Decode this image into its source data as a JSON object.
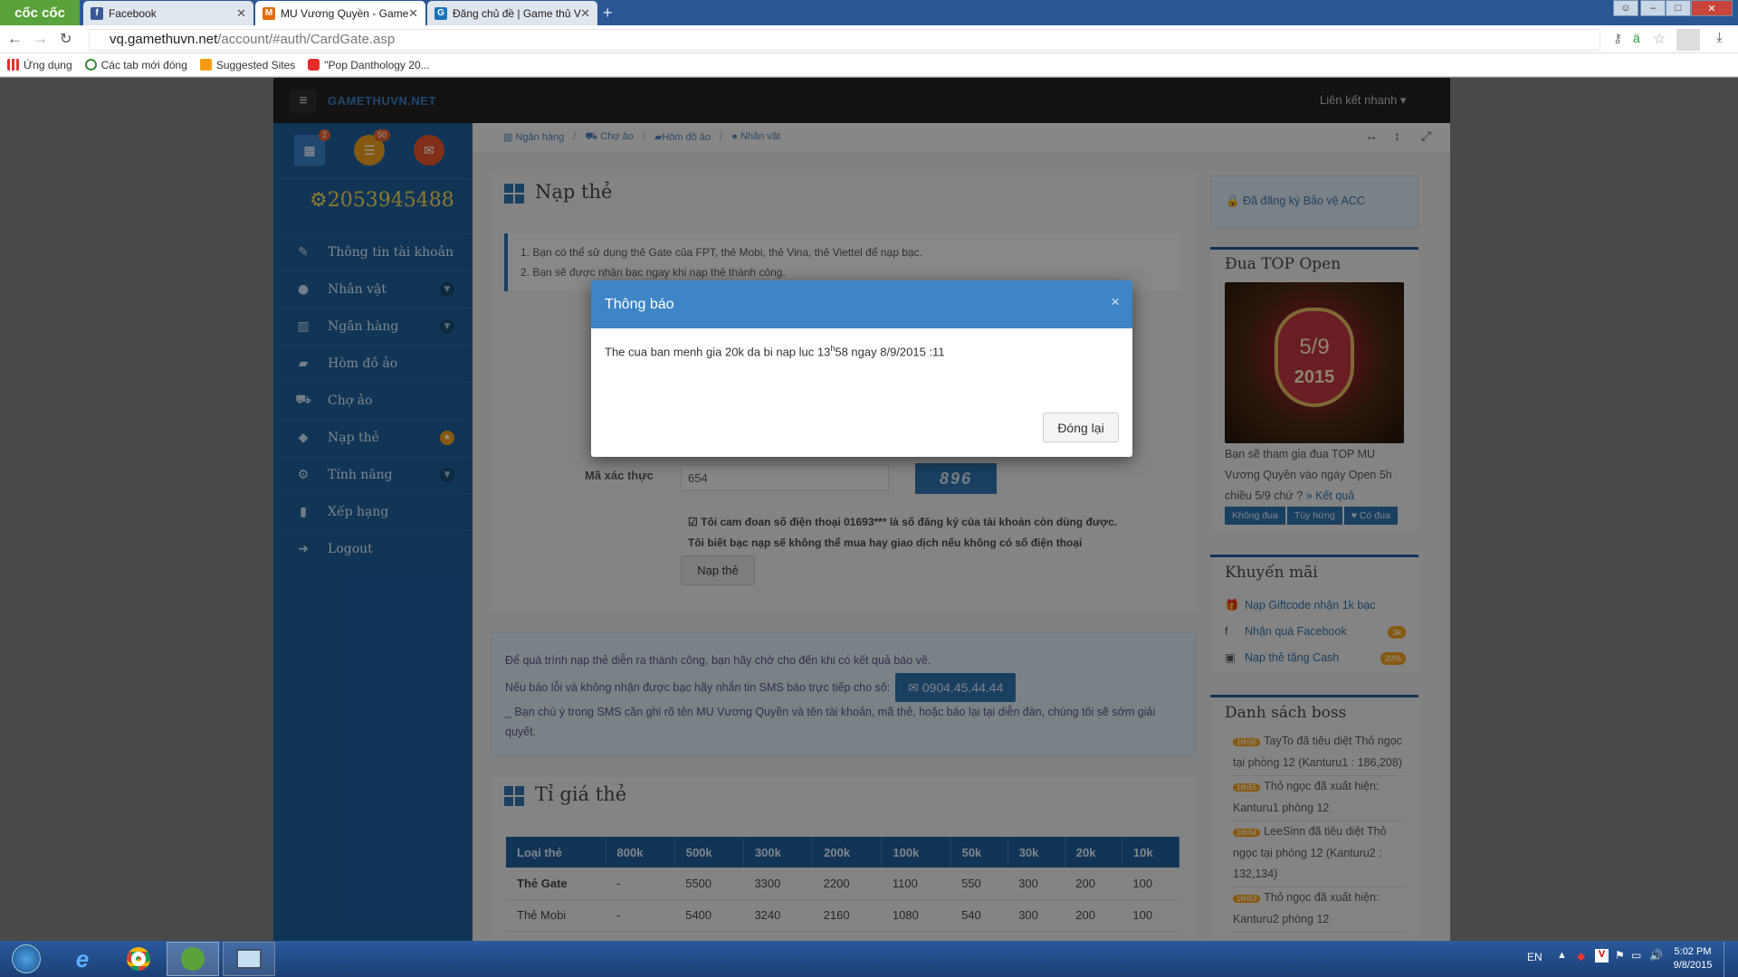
{
  "browser": {
    "logo": "cốc cốc",
    "tabs": [
      {
        "title": "Facebook",
        "fav_color": "#3b5998",
        "fav": "f"
      },
      {
        "title": "MU Vương Quyền - Game",
        "fav_color": "#e46c0a",
        "fav": "M"
      },
      {
        "title": "Đăng chủ đề | Game thủ V",
        "fav_color": "#1a73b8",
        "fav": "G"
      }
    ],
    "new_tab": "+",
    "url_host": "vq.gamethuvn.net",
    "url_path": "/account/#auth/CardGate.asp",
    "bookmarks": [
      "Ứng dụng",
      "Các tab mới đóng",
      "Suggested Sites",
      "\"Pop Danthology 20..."
    ]
  },
  "site": {
    "brand": "GAMETHUVN.NET",
    "quick_links": "Liên kết nhanh",
    "badges": {
      "calendar": "2",
      "list": "50"
    },
    "balance": "2053945488",
    "menu": [
      {
        "label": "Thông tin tài khoản",
        "icon": "edit-icon",
        "glyph": "✎",
        "chev": ""
      },
      {
        "label": "Nhân vật",
        "icon": "user-icon",
        "glyph": "●",
        "chev": "▼"
      },
      {
        "label": "Ngân hàng",
        "icon": "bank-icon",
        "glyph": "▥",
        "chev": "▼"
      },
      {
        "label": "Hòm đồ ảo",
        "icon": "briefcase-icon",
        "glyph": "▰",
        "chev": ""
      },
      {
        "label": "Chợ ảo",
        "icon": "cart-icon",
        "glyph": "⛟",
        "chev": ""
      },
      {
        "label": "Nạp thẻ",
        "icon": "diamond-icon",
        "glyph": "◆",
        "chev": "★"
      },
      {
        "label": "Tính năng",
        "icon": "cogs-icon",
        "glyph": "⚙",
        "chev": "▼"
      },
      {
        "label": "Xếp hạng",
        "icon": "bar-chart-icon",
        "glyph": "▮",
        "chev": ""
      },
      {
        "label": "Logout",
        "icon": "logout-icon",
        "glyph": "➜",
        "chev": ""
      }
    ],
    "breadcrumb": [
      "Ngân hàng",
      "Chợ ảo",
      "Hòm đồ ảo",
      "Nhân vật"
    ]
  },
  "main": {
    "title": "Nạp thẻ",
    "notes": [
      "1. Bạn có thể sử dụng thẻ Gate của FPT, thẻ Mobi, thẻ Vina, thẻ Viettel để nạp bạc.",
      "2. Bạn sẽ được nhận bạc ngay khi nạp thẻ thành công."
    ],
    "captcha_label": "Mã xác thực",
    "captcha_value": "654",
    "captcha_image": "896",
    "agree_line1": "Tôi cam đoan số điện thoại 01693*** là số đăng ký của tài khoản còn dùng được.",
    "agree_line2": "Tôi biết bạc nạp sẽ không thể mua hay giao dịch nếu không có số điện thoại",
    "submit": "Nạp thẻ",
    "info_1": "Để quá trình nạp thẻ diễn ra thành công, bạn hãy chờ cho đến khi có kết quả báo về.",
    "info_2": "Nếu báo lỗi và không nhận được bạc hãy nhắn tin SMS báo trực tiếp cho số:",
    "phone": "0904.45.44.44",
    "info_3": "_ Bạn chú ý trong SMS cần ghi rõ tên MU Vương Quyền và tên tài khoản, mã thẻ, hoặc báo lại tại diễn đàn, chúng tôi sẽ sớm giải quyết.",
    "rate_title": "Tỉ giá thẻ",
    "rate_headers": [
      "Loại thẻ",
      "800k",
      "500k",
      "300k",
      "200k",
      "100k",
      "50k",
      "30k",
      "20k",
      "10k"
    ],
    "rate_rows": [
      [
        "Thẻ Gate",
        "-",
        "5500",
        "3300",
        "2200",
        "1100",
        "550",
        "300",
        "200",
        "100"
      ],
      [
        "Thẻ Mobi",
        "-",
        "5400",
        "3240",
        "2160",
        "1080",
        "540",
        "300",
        "200",
        "100"
      ]
    ]
  },
  "right": {
    "protect": "Đã đăng ký Bảo vệ ACC",
    "top_title": "Đua TOP Open",
    "top_date": "5/9",
    "top_year": "2015",
    "top_desc": "Bạn sẽ tham gia đua TOP MU Vương Quyền vào ngày Open 5h chiều 5/9 chứ ?",
    "top_link": "» Kết quả",
    "top_buttons": [
      "Không đua",
      "Tùy hứng",
      "♥ Có đua"
    ],
    "promo_title": "Khuyến mãi",
    "promos": [
      {
        "label": "Nạp Giftcode nhận 1k bạc",
        "badge": ""
      },
      {
        "label": "Nhận quà Facebook",
        "badge": "3k"
      },
      {
        "label": "Nạp thẻ tặng Cash",
        "badge": "20%"
      }
    ],
    "boss_title": "Danh sách boss",
    "boss": [
      {
        "time": "16h56",
        "text": "TayTo đã tiêu diệt Thỏ ngọc tại phòng 12 (Kanturu1 : 186,208)"
      },
      {
        "time": "16h55",
        "text": "Thỏ ngọc đã xuất hiện: Kanturu1 phòng 12"
      },
      {
        "time": "16h54",
        "text": "LeeSinn đã tiêu diệt Thỏ ngọc tại phòng 12 (Kanturu2 : 132,134)"
      },
      {
        "time": "16h53",
        "text": "Thỏ ngọc đã xuất hiện: Kanturu2 phòng 12"
      }
    ]
  },
  "modal": {
    "title": "Thông báo",
    "msg_pre": "The cua ban menh gia 20k da bi nap luc 13",
    "msg_sup": "h",
    "msg_post": "58 ngay 8/9/2015 :11",
    "button": "Đóng lại",
    "close": "×"
  },
  "taskbar": {
    "lang": "EN",
    "time": "5:02 PM",
    "date": "9/8/2015"
  }
}
